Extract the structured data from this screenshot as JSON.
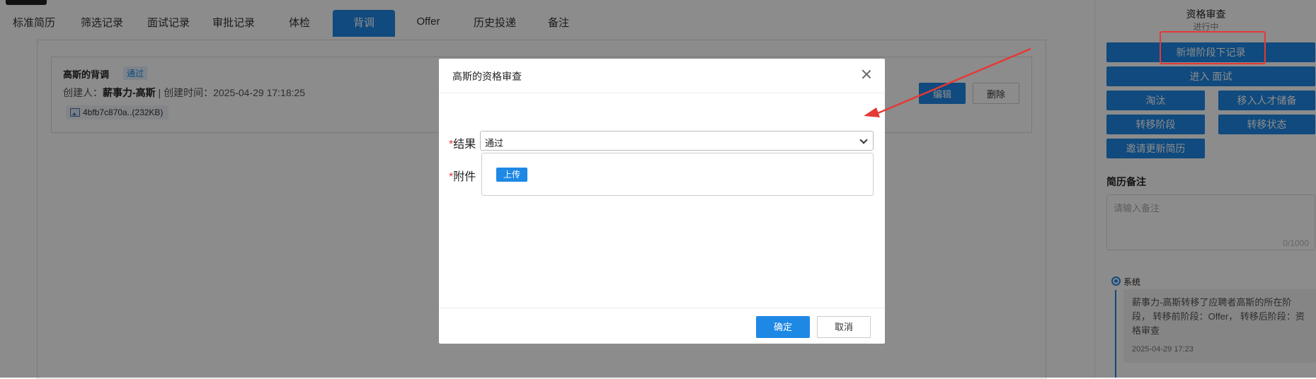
{
  "tabs": [
    {
      "label": "标准简历"
    },
    {
      "label": "筛选记录"
    },
    {
      "label": "面试记录"
    },
    {
      "label": "审批记录"
    },
    {
      "label": "体检"
    },
    {
      "label": "背调",
      "active": true
    },
    {
      "label": "Offer"
    },
    {
      "label": "历史投递"
    },
    {
      "label": "备注"
    }
  ],
  "record": {
    "title": "高斯的背调",
    "badge": "通过",
    "creator_label": "创建人：",
    "creator": "薪事力-高斯",
    "created_label": " | 创建时间：",
    "created_time": "2025-04-29 17:18:25",
    "file": "4bfb7c870a..(232KB)",
    "edit_label": "编辑",
    "delete_label": "删除"
  },
  "sidebar": {
    "title": "资格审查",
    "status": "进行中",
    "buttons": {
      "add_record": "新增阶段下记录",
      "enter_interview": "进入 面试",
      "eliminate": "淘汰",
      "talent_pool": "移入人才储备",
      "transfer_stage": "转移阶段",
      "transfer_status": "转移状态",
      "invite_update": "邀请更新简历"
    },
    "notes_label": "简历备注",
    "notes_placeholder": "请输入备注",
    "notes_count": "0/1000",
    "timeline": {
      "who": "系统",
      "text": "薪事力-高斯转移了应聘者高斯的所在阶段， 转移前阶段：Offer， 转移后阶段：资格审查",
      "time": "2025-04-29 17:23"
    }
  },
  "dialog": {
    "title": "高斯的资格审查",
    "required_mark": "*",
    "result_label": "结果",
    "result_value": "通过",
    "attachment_label": "附件",
    "upload_label": "上传",
    "ok_label": "确定",
    "cancel_label": "取消"
  },
  "colors": {
    "primary": "#1e88e5",
    "highlight": "#e53935"
  },
  "icons": [
    "close-icon",
    "image-file-icon",
    "chevron-down-icon",
    "radio-dot-icon",
    "annotation-arrow"
  ]
}
